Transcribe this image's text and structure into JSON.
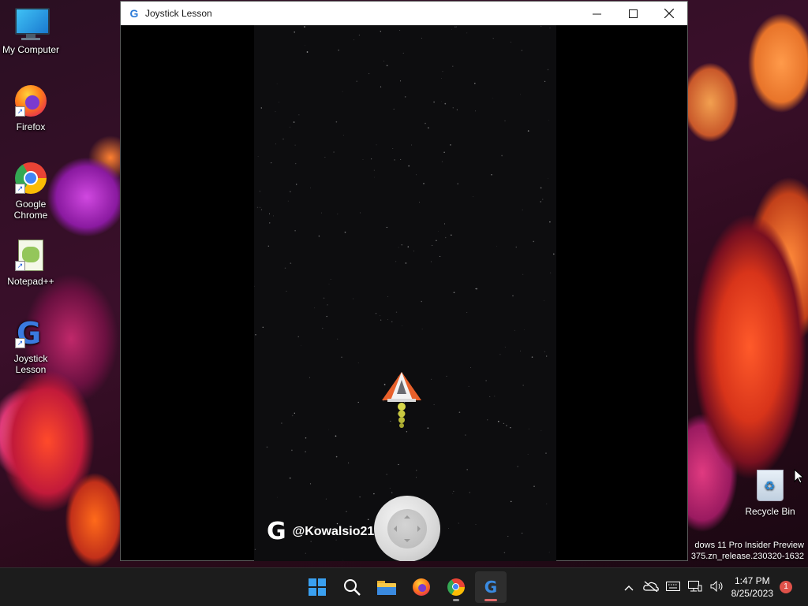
{
  "desktop": {
    "icons": [
      {
        "label": "My Computer",
        "icon": "monitor-icon"
      },
      {
        "label": "Firefox",
        "icon": "firefox-icon"
      },
      {
        "label": "Google Chrome",
        "icon": "chrome-icon"
      },
      {
        "label": "Notepad++",
        "icon": "notepadpp-icon"
      },
      {
        "label": "Joystick Lesson",
        "icon": "gdevelop-icon"
      }
    ],
    "recycle_bin": {
      "label": "Recycle Bin"
    },
    "watermark": {
      "line1": "dows 11 Pro Insider Preview",
      "line2": "375.zn_release.230320-1632"
    }
  },
  "window": {
    "title": "Joystick Lesson",
    "icon": "gdevelop-icon",
    "buttons": {
      "minimize": "—",
      "maximize": "☐",
      "close": "✕"
    }
  },
  "game": {
    "handle": "@Kowalsio212",
    "brand_logo": "G"
  },
  "taskbar": {
    "apps": [
      "start-icon",
      "search-icon",
      "file-explorer-icon",
      "firefox-icon",
      "chrome-icon",
      "gdevelop-icon"
    ],
    "clock": {
      "time": "1:47 PM",
      "date": "8/25/2023"
    },
    "notification_count": "1"
  }
}
